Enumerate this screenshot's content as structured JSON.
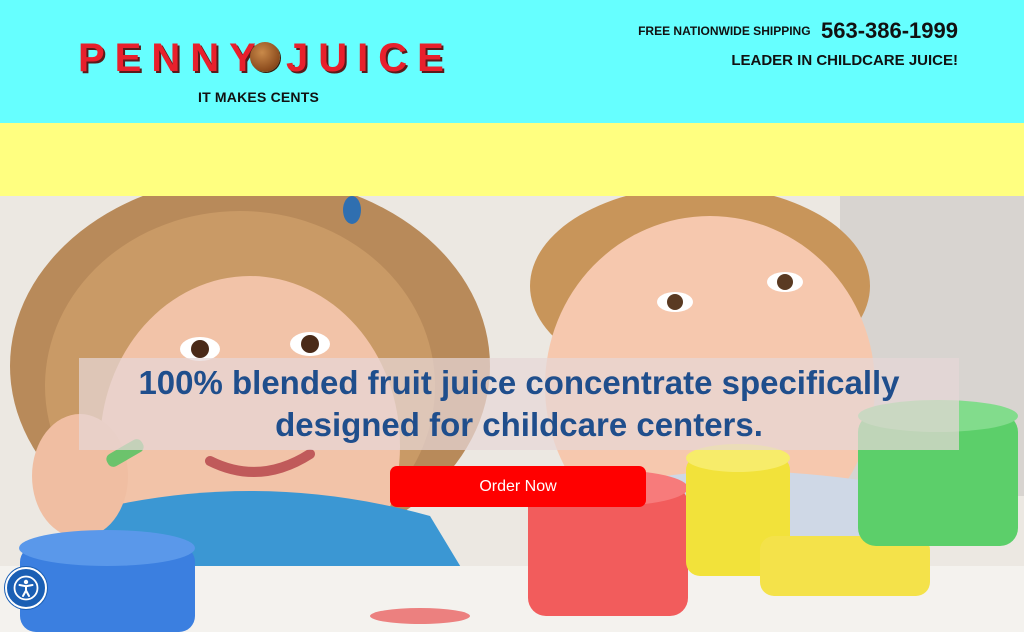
{
  "header": {
    "logo": {
      "left_word": "PENNY",
      "right_word": "JUICE",
      "tagline": "IT MAKES CENTS"
    },
    "contact": {
      "shipping": "FREE NATIONWIDE SHIPPING",
      "phone": "563-386-1999",
      "tagline": "LEADER IN CHILDCARE JUICE!"
    }
  },
  "hero": {
    "headline": "100% blended fruit juice concentrate specifically designed for childcare centers.",
    "cta_label": "Order Now"
  },
  "accessibility": {
    "icon": "accessibility-icon"
  },
  "colors": {
    "header_bg": "#66ffff",
    "band_bg": "#ffff80",
    "brand_red": "#e8202c",
    "headline_blue": "#1f4e8c",
    "cta_red": "#ff0000"
  }
}
